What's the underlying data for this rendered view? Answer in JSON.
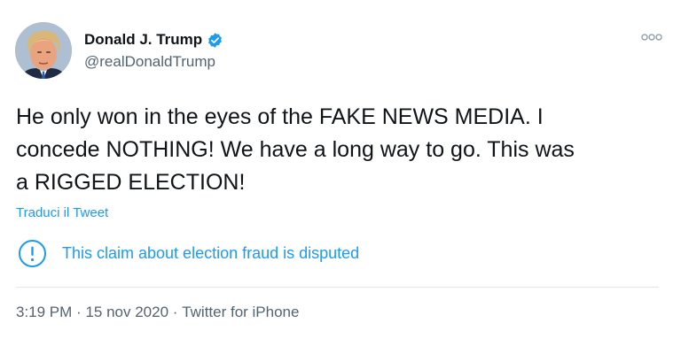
{
  "author": {
    "name": "Donald J. Trump",
    "handle": "@realDonaldTrump",
    "avatar_icon": "profile-photo-avatar",
    "verified_icon": "verified-badge-icon"
  },
  "tweet": {
    "text": "He only won in the eyes of the FAKE NEWS MEDIA. I\nconcede NOTHING! We have a long way to go. This was\na RIGGED ELECTION!",
    "translate_label": "Traduci il Tweet"
  },
  "notice": {
    "icon": "exclamation-circle-icon",
    "text": "This claim about election fraud is disputed"
  },
  "meta": {
    "time": "3:19 PM",
    "separator": "·",
    "date": "15 nov 2020",
    "source": "Twitter for iPhone"
  },
  "menu": {
    "icon": "more-options-icon"
  },
  "colors": {
    "accent": "#1d9bf0",
    "text": "#0f1419",
    "secondary": "#536471",
    "divider": "#e1e8ed"
  }
}
